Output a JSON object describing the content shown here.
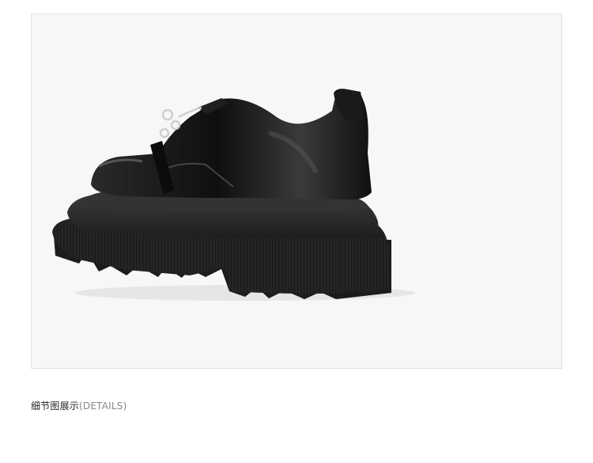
{
  "detail_section": {
    "title_cn": "细节图展示",
    "title_en": "(DETAILS)"
  },
  "photo": {
    "subject": "black-platform-lace-up-shoe",
    "colors": {
      "background": "#f7f7f7",
      "leather": "#121212",
      "sole": "#2b2b2b",
      "metal": "#c9c9c9"
    }
  }
}
